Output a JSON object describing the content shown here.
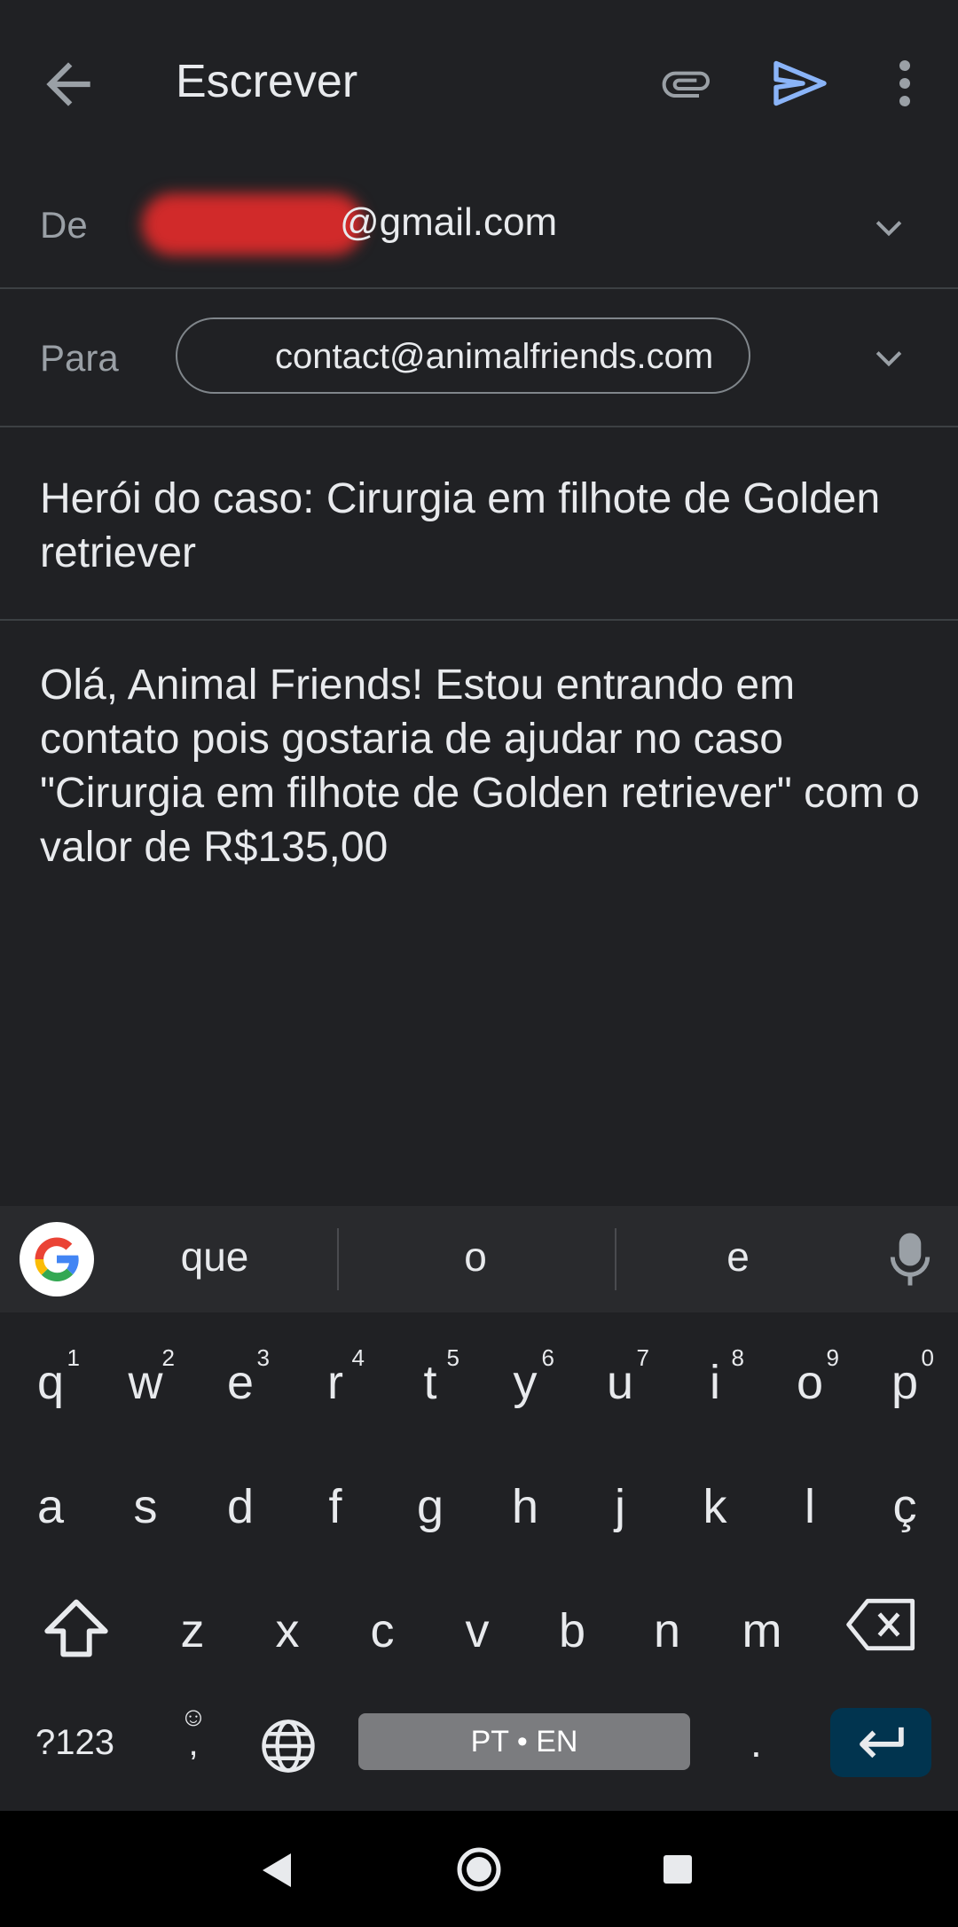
{
  "header": {
    "title": "Escrever",
    "icons": [
      "back-arrow-icon",
      "paperclip-icon",
      "send-icon",
      "more-vert-icon"
    ],
    "send_color": "#8ab4f8"
  },
  "from": {
    "label": "De",
    "email_visible": "@gmail.com"
  },
  "to": {
    "label": "Para",
    "recipient": "contact@animalfriends.com"
  },
  "subject": "Herói do caso: Cirurgia em filhote de Golden retriever",
  "body": "Olá, Animal Friends! Estou entrando em contato pois gostaria de ajudar no caso \"Cirurgia em filhote de Golden retriever\" com o valor de R$135,00",
  "keyboard": {
    "suggestions": [
      "que",
      "o",
      "e"
    ],
    "row1": [
      {
        "key": "q",
        "hint": "1"
      },
      {
        "key": "w",
        "hint": "2"
      },
      {
        "key": "e",
        "hint": "3"
      },
      {
        "key": "r",
        "hint": "4"
      },
      {
        "key": "t",
        "hint": "5"
      },
      {
        "key": "y",
        "hint": "6"
      },
      {
        "key": "u",
        "hint": "7"
      },
      {
        "key": "i",
        "hint": "8"
      },
      {
        "key": "o",
        "hint": "9"
      },
      {
        "key": "p",
        "hint": "0"
      }
    ],
    "row2": [
      "a",
      "s",
      "d",
      "f",
      "g",
      "h",
      "j",
      "k",
      "l",
      "ç"
    ],
    "row3": [
      "z",
      "x",
      "c",
      "v",
      "b",
      "n",
      "m"
    ],
    "numbers_label": "?123",
    "emoji_label": "☺",
    "comma_label": ",",
    "space_label": "PT • EN",
    "period_label": ".",
    "enter_color": "#01344f"
  }
}
